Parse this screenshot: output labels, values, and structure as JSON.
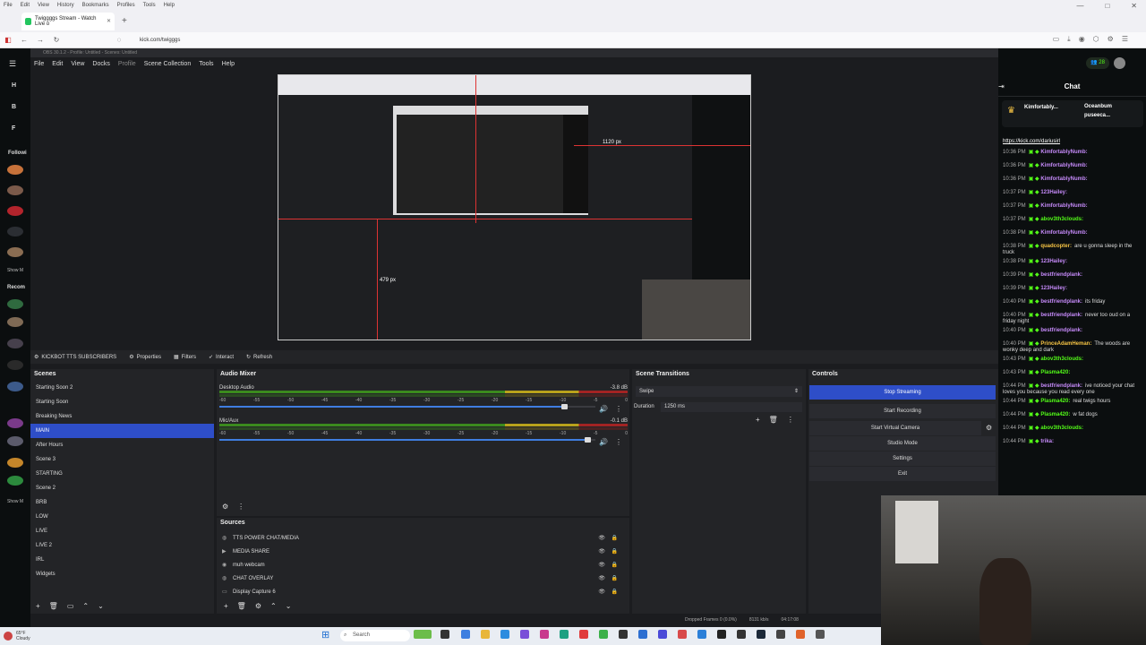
{
  "browser": {
    "menu": [
      "File",
      "Edit",
      "View",
      "History",
      "Bookmarks",
      "Profiles",
      "Tools",
      "Help"
    ],
    "tab_title": "Twiggggs Stream - Watch Live o",
    "url": "kick.com/twigggs",
    "window_controls": [
      "—",
      "□",
      "✕"
    ]
  },
  "kick": {
    "sidebar_letters": [
      "H",
      "B",
      "F"
    ],
    "following_label": "Followi",
    "show_more": "Show M",
    "recommended_label": "Recom",
    "viewer_count": "28"
  },
  "obs": {
    "title": "OBS 30.1.2 - Profile: Untitled - Scenes: Untitled",
    "menu": [
      "File",
      "Edit",
      "View",
      "Docks",
      "Profile",
      "Scene Collection",
      "Tools",
      "Help"
    ],
    "preview_labels": {
      "width_px": "1120 px",
      "height_px": "479 px"
    },
    "toolbar": {
      "source_name": "KICKBOT TTS SUBSCRIBERS",
      "properties": "Properties",
      "filters": "Filters",
      "interact": "Interact",
      "refresh": "Refresh"
    },
    "scenes": {
      "header": "Scenes",
      "items": [
        "Starting Soon 2",
        "Starting Soon",
        "Breaking News",
        "MAIN",
        "After Hours",
        "Scene 3",
        "STARTING",
        "Scene 2",
        "BRB",
        "LOW",
        "LIVE",
        "LIVE 2",
        "IRL",
        "Widgets"
      ],
      "selected_index": 3
    },
    "audio_mixer": {
      "header": "Audio Mixer",
      "channels": [
        {
          "name": "Desktop Audio",
          "db": "-3.8 dB",
          "volume": 0.92
        },
        {
          "name": "Mic/Aux",
          "db": "-0.1 dB",
          "volume": 0.98
        }
      ],
      "ticks": [
        "-60",
        "-55",
        "-50",
        "-45",
        "-40",
        "-35",
        "-30",
        "-25",
        "-20",
        "-15",
        "-10",
        "-5",
        "0"
      ]
    },
    "sources": {
      "header": "Sources",
      "items": [
        "TTS POWER CHAT/MEDIA",
        "MEDIA SHARE",
        "muh webcam",
        "CHAT OVERLAY",
        "Display Capture 6"
      ]
    },
    "scene_transitions": {
      "header": "Scene Transitions",
      "transition": "Swipe",
      "duration_label": "Duration",
      "duration_value": "1250 ms"
    },
    "controls": {
      "header": "Controls",
      "buttons": [
        "Stop Streaming",
        "Start Recording",
        "Start Virtual Camera",
        "Studio Mode",
        "Settings",
        "Exit"
      ]
    },
    "status": {
      "dropped": "Dropped Frames 0 (0.0%)",
      "bitrate": "8131 kb/s",
      "time": "04:17:08"
    }
  },
  "chat": {
    "header": "Chat",
    "pinned": [
      "Kimfortably...",
      "Oceanbum",
      "puseeca..."
    ],
    "link": "https://kick.com/dariusirl",
    "messages": [
      {
        "time": "10:36 PM",
        "user": "KimfortablyNumb:",
        "text": "",
        "color": "#c58af9"
      },
      {
        "time": "10:36 PM",
        "user": "KimfortablyNumb:",
        "text": "",
        "color": "#c58af9"
      },
      {
        "time": "10:36 PM",
        "user": "KimfortablyNumb:",
        "text": "",
        "color": "#c58af9"
      },
      {
        "time": "10:37 PM",
        "user": "123Hailey:",
        "text": "",
        "color": "#c58af9"
      },
      {
        "time": "10:37 PM",
        "user": "KimfortablyNumb:",
        "text": "",
        "color": "#c58af9"
      },
      {
        "time": "10:37 PM",
        "user": "abov3th3clouds:",
        "text": "",
        "color": "#53fc18"
      },
      {
        "time": "10:38 PM",
        "user": "KimfortablyNumb:",
        "text": "",
        "color": "#c58af9"
      },
      {
        "time": "10:38 PM",
        "user": "quadcopter:",
        "text": "are u gonna sleep in the truck",
        "color": "#f5c344"
      },
      {
        "time": "10:38 PM",
        "user": "123Hailey:",
        "text": "",
        "color": "#c58af9"
      },
      {
        "time": "10:39 PM",
        "user": "bestfriendplank:",
        "text": "",
        "color": "#c58af9"
      },
      {
        "time": "10:39 PM",
        "user": "123Hailey:",
        "text": "",
        "color": "#c58af9"
      },
      {
        "time": "10:40 PM",
        "user": "bestfriendplank:",
        "text": "its friday",
        "color": "#c58af9"
      },
      {
        "time": "10:40 PM",
        "user": "bestfriendplank:",
        "text": "never too oud on a friday night",
        "color": "#c58af9"
      },
      {
        "time": "10:40 PM",
        "user": "bestfriendplank:",
        "text": "",
        "color": "#c58af9"
      },
      {
        "time": "10:40 PM",
        "user": "PrinceAdamHeman:",
        "text": "The woods are wonky deep and dark",
        "color": "#f5c344"
      },
      {
        "time": "10:43 PM",
        "user": "abov3th3clouds:",
        "text": "",
        "color": "#53fc18"
      },
      {
        "time": "10:43 PM",
        "user": "Plasma420:",
        "text": "",
        "color": "#53fc18"
      },
      {
        "time": "10:44 PM",
        "user": "bestfriendplank:",
        "text": "ive noticed your chat loves you because you read every one",
        "color": "#c58af9"
      },
      {
        "time": "10:44 PM",
        "user": "Plasma420:",
        "text": "real twigs hours",
        "color": "#53fc18"
      },
      {
        "time": "10:44 PM",
        "user": "Plasma420:",
        "text": "w fat dogs",
        "color": "#53fc18"
      },
      {
        "time": "10:44 PM",
        "user": "abov3th3clouds:",
        "text": "",
        "color": "#53fc18"
      },
      {
        "time": "10:44 PM",
        "user": "trika:",
        "text": "",
        "color": "#c58af9"
      }
    ]
  },
  "taskbar": {
    "search_placeholder": "Search",
    "weather_temp": "65°F",
    "weather_desc": "Cloudy"
  },
  "colors": {
    "accent": "#2e4ec8",
    "kick_green": "#53fc18"
  }
}
